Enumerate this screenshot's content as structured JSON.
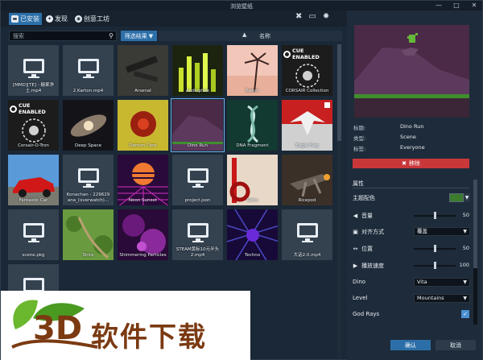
{
  "window": {
    "title": "浏览壁纸"
  },
  "window_controls": {
    "minimize": "—",
    "maximize": "□",
    "close": "✕"
  },
  "nav": {
    "tabs": [
      {
        "label": "已安装",
        "icon": "hard-drive-icon"
      },
      {
        "label": "发现",
        "icon": "compass-icon"
      },
      {
        "label": "创意工坊",
        "icon": "steam-icon"
      }
    ],
    "tools": [
      "wrench-icon",
      "monitor-icon",
      "gear-icon"
    ]
  },
  "search": {
    "placeholder": "搜索",
    "value": ""
  },
  "filter": {
    "label": "筛选结果"
  },
  "sort": {
    "label": "名称"
  },
  "cue_badge": "CUE ENABLED",
  "tiles": [
    {
      "caption": "[MMD][TE] - 糖果净土.mp4",
      "kind": "monitor"
    },
    {
      "caption": "2.Karton.mp4",
      "kind": "monitor"
    },
    {
      "caption": "Arsenal",
      "kind": "art"
    },
    {
      "caption": "Audiophile",
      "kind": "art"
    },
    {
      "caption": "Beach",
      "kind": "art"
    },
    {
      "caption": "CORSAIR Collection",
      "kind": "cue"
    },
    {
      "caption": "Corsair-O-Tron",
      "kind": "cue"
    },
    {
      "caption": "Deep Space",
      "kind": "art"
    },
    {
      "caption": "Demon Core",
      "kind": "art"
    },
    {
      "caption": "Dino Run",
      "kind": "art"
    },
    {
      "caption": "DNA Fragment",
      "kind": "art"
    },
    {
      "caption": "Eagle Flag",
      "kind": "art"
    },
    {
      "caption": "Fantastic Car",
      "kind": "art"
    },
    {
      "caption": "Konachan - 229629 ana_(overwatch)...",
      "kind": "monitor"
    },
    {
      "caption": "Neon Sunset",
      "kind": "art"
    },
    {
      "caption": "project.json",
      "kind": "monitor"
    },
    {
      "caption": "Retro",
      "kind": "art"
    },
    {
      "caption": "Ricepod",
      "kind": "art"
    },
    {
      "caption": "scene.pkg",
      "kind": "monitor"
    },
    {
      "caption": "Shire",
      "kind": "art"
    },
    {
      "caption": "Shimmering Particles",
      "kind": "art"
    },
    {
      "caption": "STEAM黄标10元半头2.mp4",
      "kind": "monitor"
    },
    {
      "caption": "Techno",
      "kind": "art"
    },
    {
      "caption": "大话2.0.mp4",
      "kind": "monitor"
    },
    {
      "caption": "",
      "kind": "monitor"
    }
  ],
  "details": {
    "title_label": "标题:",
    "title_value": "Dino Run",
    "type_label": "类型:",
    "type_value": "Scene",
    "tag_label": "标签:",
    "tag_value": "Everyone",
    "remove_label": "移除"
  },
  "properties": {
    "heading": "属性",
    "theme_color_label": "主题配色",
    "theme_color": "#3a7b2c",
    "volume_label": "音量",
    "volume_value": "50",
    "align_label": "对齐方式",
    "align_value": "覆盖",
    "position_label": "位置",
    "position_value": "50",
    "speed_label": "播放速度",
    "speed_value": "100",
    "dino_label": "Dino",
    "dino_value": "Vita",
    "level_label": "Level",
    "level_value": "Mountains",
    "godrays_label": "God Rays",
    "godrays_checked": "✓"
  },
  "footer": {
    "ok": "确认",
    "cancel": "取消"
  },
  "watermark": {
    "logo": "3D",
    "text": "软件下载"
  }
}
